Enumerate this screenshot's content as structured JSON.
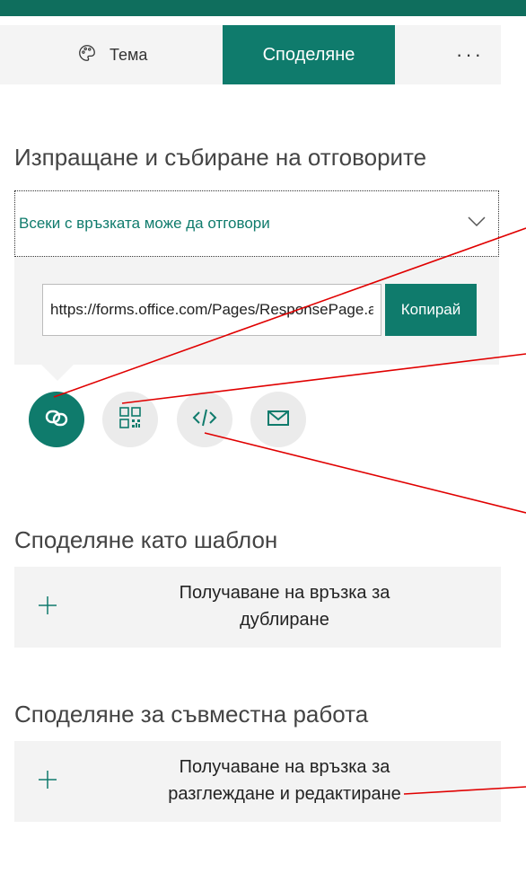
{
  "tabs": {
    "theme_label": "Тема",
    "share_label": "Споделяне",
    "more_label": "···"
  },
  "send_section": {
    "title": "Изпращане и събиране на отговорите",
    "dropdown_value": "Всеки с връзката може да отговори",
    "link_url": "https://forms.office.com/Pages/ResponsePage.aspx",
    "copy_label": "Копирай"
  },
  "share_icons": [
    {
      "name": "link-icon"
    },
    {
      "name": "qr-code-icon"
    },
    {
      "name": "embed-icon"
    },
    {
      "name": "email-icon"
    }
  ],
  "template_section": {
    "title": "Споделяне като шаблон",
    "action_line1": "Получаване на връзка за",
    "action_line2": "дублиране"
  },
  "collab_section": {
    "title": "Споделяне за съвместна работа",
    "action_line1": "Получаване на връзка за",
    "action_line2": "разглеждане и редактиране"
  },
  "colors": {
    "accent": "#0f7b6c",
    "top_bar": "#0f6e5d",
    "annotation": "#e00000"
  }
}
